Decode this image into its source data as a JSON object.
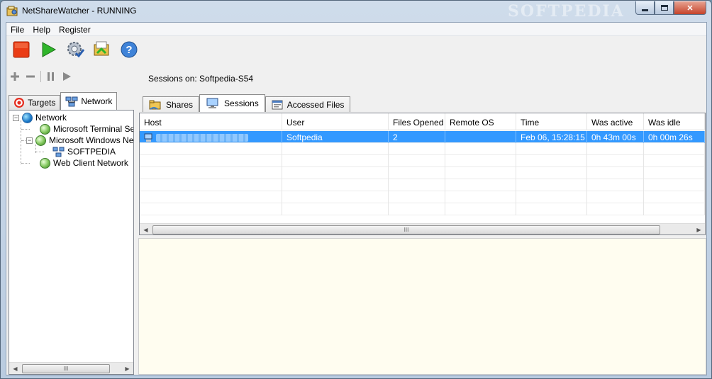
{
  "window": {
    "title": "NetShareWatcher - RUNNING",
    "watermark": "SOFTPEDIA"
  },
  "menu": [
    "File",
    "Help",
    "Register"
  ],
  "toolbar": {
    "buttons": [
      "stop-icon",
      "start-icon",
      "settings-icon",
      "folder-icon",
      "help-icon"
    ]
  },
  "left": {
    "tabs": [
      {
        "label": "Targets",
        "icon": "target-icon"
      },
      {
        "label": "Network",
        "icon": "network-icon"
      }
    ],
    "tree": {
      "root": "Network",
      "items": [
        {
          "label": "Microsoft Terminal Services"
        },
        {
          "label": "Microsoft Windows Network",
          "children": [
            "SOFTPEDIA"
          ]
        },
        {
          "label": "Web Client Network"
        }
      ]
    },
    "scroll_thumb": "III"
  },
  "right": {
    "sessions_on": "Sessions on: Softpedia-S54",
    "tabs": [
      "Shares",
      "Sessions",
      "Accessed Files"
    ],
    "active_tab": "Sessions",
    "columns": [
      "Host",
      "User",
      "Files Opened",
      "Remote OS",
      "Time",
      "Was active",
      "Was idle"
    ],
    "rows": [
      {
        "host": "",
        "user": "Softpedia",
        "files_opened": "2",
        "remote_os": "",
        "time": "Feb 06, 15:28:15",
        "was_active": "0h 43m 00s",
        "was_idle": "0h 00m 26s"
      }
    ],
    "scroll_thumb": "III"
  },
  "colors": {
    "selection": "#3399ff",
    "details_bg": "#fffdf0"
  }
}
